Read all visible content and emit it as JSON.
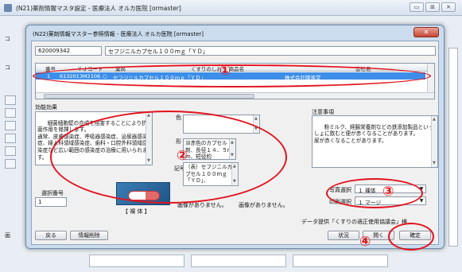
{
  "outer_window": {
    "title": "(N21)薬剤情報マスタ設定 - 医療法人 オルカ医院 [ormaster]",
    "bg_labels": [
      "コ",
      "コ",
      "画"
    ]
  },
  "dialog": {
    "title": "(N22)薬剤情報マスター参照情報 - 医療法人 オルカ医院 [ormaster]",
    "code_value": "620009342",
    "name_value": "セフジニルカプセル１００ｍｇ「ＹＤ」",
    "table": {
      "columns": [
        "番号",
        "ＹＪコード",
        "薬局",
        "くすりのしおり 商品名",
        "会社名"
      ],
      "rows": [
        {
          "no": "1",
          "yj": "6132013M2106",
          "pharmacy": "○",
          "name": "セフジニルカプセル１００ｍｇ「ＹＤ」",
          "company": "株式会社陽進堂"
        }
      ]
    },
    "efficacy": {
      "label": "効能効果",
      "text": "細菌細胞壁の合成を阻害することにより抗菌作用を発揮します。\n通常、皮膚感染症、呼吸器感染症、泌尿器感染症、婦人科領域感染症、歯科・口腔外科領域感染症など広い範囲の感染症の治療に用いられます。"
    },
    "color": {
      "label": "色",
      "value": ""
    },
    "shape": {
      "label": "形",
      "value": "淡赤色のカプセル剤、長径１４．５ｍｍ、短径約"
    },
    "mark": {
      "label": "記号",
      "value": "（表）セフジニルカプセル１００ｍｇ「ＹＤ」、"
    },
    "caution": {
      "label": "注意事項",
      "text": "粉ミルク、経腸栄養剤などの鉄添加製品といっしょに飲むと便が赤くなることがあります。\n尿が赤くなることがあります。"
    },
    "select_no_label": "選択番号",
    "select_no_value": "1",
    "image_caption": "【 裸 体 】",
    "no_image_1": "画像がありません。",
    "no_image_2": "画像がありません。",
    "photo_select": {
      "label": "写真選択",
      "value": "１ 裸体"
    },
    "print_select": {
      "label": "印刷選択",
      "value": "１ マージ"
    },
    "data_provider": "データ提供「くすりの適正使用協議会」様",
    "buttons": {
      "back": "戻る",
      "delete_info": "情報削除",
      "status": "状況",
      "open": "開く",
      "confirm": "確定"
    },
    "colors": {
      "accent": "#3d8ee8",
      "annotation": "#e2131d"
    },
    "annotations": [
      "①",
      "②",
      "③",
      "④"
    ]
  }
}
